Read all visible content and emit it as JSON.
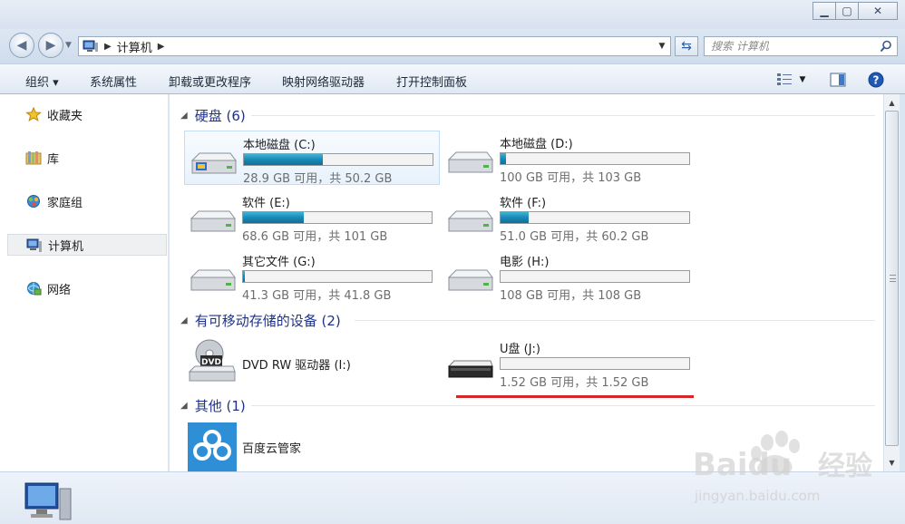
{
  "window": {
    "minimize_icon": "minimize-icon",
    "maximize_icon": "maximize-icon",
    "close_icon": "close-icon"
  },
  "address": {
    "path_item": "计算机",
    "search_placeholder": "搜索 计算机"
  },
  "toolbar": {
    "organize": "组织 ▾",
    "system_properties": "系统属性",
    "uninstall": "卸载或更改程序",
    "map_drive": "映射网络驱动器",
    "control_panel": "打开控制面板"
  },
  "sidebar": {
    "items": [
      {
        "label": "收藏夹",
        "icon": "star-icon"
      },
      {
        "label": "库",
        "icon": "library-icon"
      },
      {
        "label": "家庭组",
        "icon": "homegroup-icon"
      },
      {
        "label": "计算机",
        "icon": "computer-icon"
      },
      {
        "label": "网络",
        "icon": "network-icon"
      }
    ]
  },
  "groups": {
    "hard_disks": "硬盘 (6)",
    "removable": "有可移动存储的设备 (2)",
    "other": "其他 (1)"
  },
  "drives": [
    {
      "name": "本地磁盘 (C:)",
      "free": "28.9 GB 可用，共 50.2 GB",
      "used_fraction": 0.42
    },
    {
      "name": "本地磁盘 (D:)",
      "free": "100 GB 可用，共 103 GB",
      "used_fraction": 0.03
    },
    {
      "name": "软件 (E:)",
      "free": "68.6 GB 可用，共 101 GB",
      "used_fraction": 0.32
    },
    {
      "name": "软件 (F:)",
      "free": "51.0 GB 可用，共 60.2 GB",
      "used_fraction": 0.15
    },
    {
      "name": "其它文件 (G:)",
      "free": "41.3 GB 可用，共 41.8 GB",
      "used_fraction": 0.01
    },
    {
      "name": "电影 (H:)",
      "free": "108 GB 可用，共 108 GB",
      "used_fraction": 0.0
    }
  ],
  "removable": {
    "dvd_name": "DVD RW 驱动器 (I:)",
    "dvd_label": "DVD",
    "usb_name": "U盘 (J:)",
    "usb_free": "1.52 GB 可用，共 1.52 GB",
    "usb_used_fraction": 0.0
  },
  "other": {
    "app_name": "百度云管家"
  },
  "watermark": {
    "brand": "Baidu",
    "brand_cn": "经验",
    "url": "jingyan.baidu.com"
  },
  "colors": {
    "bar_fill": "#1a88b6",
    "group_heading": "#1e3287",
    "highlight_line": "#d3272a"
  }
}
